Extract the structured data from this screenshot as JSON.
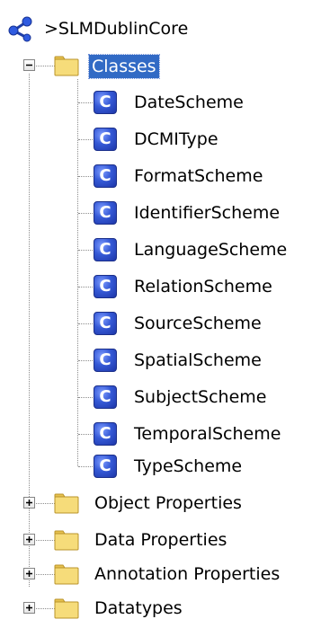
{
  "tree": {
    "root": {
      "label": ">SLMDublinCore",
      "icon": "ontology-network-icon"
    },
    "classes_folder": {
      "label": "Classes",
      "selected": true,
      "expanded": true
    },
    "classes": [
      "DateScheme",
      "DCMIType",
      "FormatScheme",
      "IdentifierScheme",
      "LanguageScheme",
      "RelationScheme",
      "SourceScheme",
      "SpatialScheme",
      "SubjectScheme",
      "TemporalScheme",
      "TypeScheme"
    ],
    "class_icon_letter": "C",
    "folders": [
      {
        "label": "Object Properties",
        "expanded": false
      },
      {
        "label": "Data Properties",
        "expanded": false
      },
      {
        "label": "Annotation Properties",
        "expanded": false
      },
      {
        "label": "Datatypes",
        "expanded": false
      }
    ]
  },
  "colors": {
    "selection": "#316ac5",
    "class_icon": "#3559d6",
    "folder": "#f3d36b"
  }
}
